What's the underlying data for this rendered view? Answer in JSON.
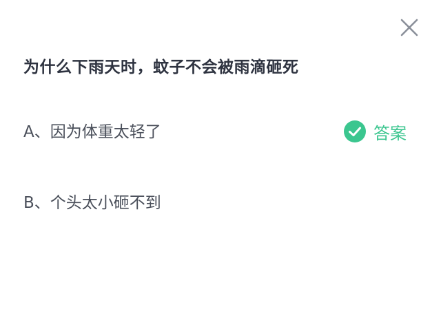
{
  "question": {
    "title": "为什么下雨天时，蚊子不会被雨滴砸死"
  },
  "options": [
    {
      "text": "A、因为体重太轻了",
      "is_answer": true
    },
    {
      "text": "B、个头太小砸不到",
      "is_answer": false
    }
  ],
  "answer_badge": {
    "label": "答案",
    "icon": "check-circle-icon",
    "color": "#3bc68f"
  },
  "close_button": {
    "icon": "close-icon"
  }
}
